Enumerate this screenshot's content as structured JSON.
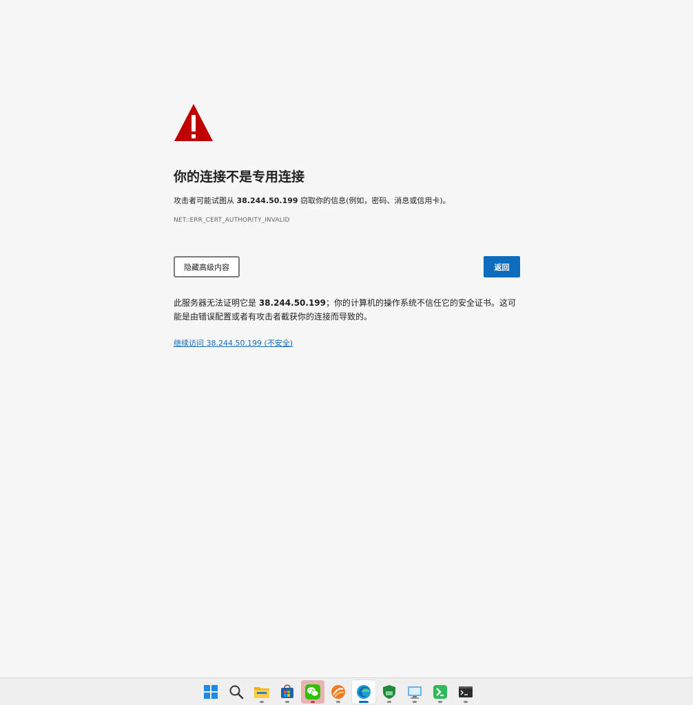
{
  "error_page": {
    "title": "你的连接不是专用连接",
    "desc_prefix": "攻击者可能试图从 ",
    "host": "38.244.50.199",
    "desc_suffix": " 窃取你的信息(例如，密码、消息或信用卡)。",
    "error_code": "NET::ERR_CERT_AUTHORITY_INVALID",
    "advanced_button": "隐藏高级内容",
    "back_button": "返回",
    "detail_prefix": "此服务器无法证明它是 ",
    "detail_suffix": "；你的计算机的操作系统不信任它的安全证书。这可能是由错误配置或者有攻击者截获你的连接而导致的。",
    "proceed_link": "继续访问 38.244.50.199 (不安全)"
  },
  "colors": {
    "warning_red": "#c00000",
    "accent_blue": "#0f6cbd",
    "background": "#f7f7f7"
  },
  "taskbar": {
    "icons": [
      "windows-start-icon",
      "search-icon",
      "file-explorer-icon",
      "store-icon",
      "wechat-icon",
      "orange-app-icon",
      "edge-icon",
      "shield-app-icon",
      "remote-desktop-icon",
      "xshell-icon",
      "terminal-icon"
    ]
  }
}
